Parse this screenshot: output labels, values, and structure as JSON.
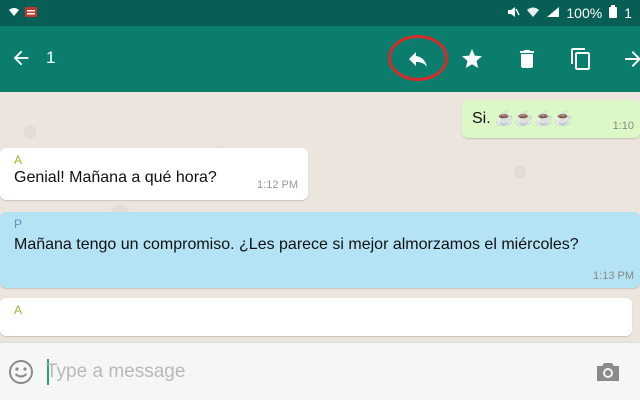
{
  "status_bar": {
    "battery": "100%",
    "clock": "1"
  },
  "toolbar": {
    "selected_count": "1"
  },
  "messages": [
    {
      "direction": "out",
      "text": "Si.",
      "emoji": "☕☕☕☕",
      "time": "1:10"
    },
    {
      "direction": "in",
      "sender": "A",
      "text": "Genial! Mañana a qué hora?",
      "time": "1:12 PM"
    },
    {
      "direction": "in",
      "sender": "P",
      "text": "Mañana tengo un compromiso. ¿Les parece si mejor almorzamos el miércoles?",
      "time": "1:13 PM"
    },
    {
      "direction": "in",
      "sender": "A"
    }
  ],
  "composer": {
    "placeholder": "Type a message"
  },
  "colors": {
    "status_bar": "#065e55",
    "toolbar": "#0a7d6c",
    "outgoing_bubble": "#dcf8c6",
    "selected_bubble": "#b3e3f5",
    "highlight_circle": "#d72b2b"
  }
}
